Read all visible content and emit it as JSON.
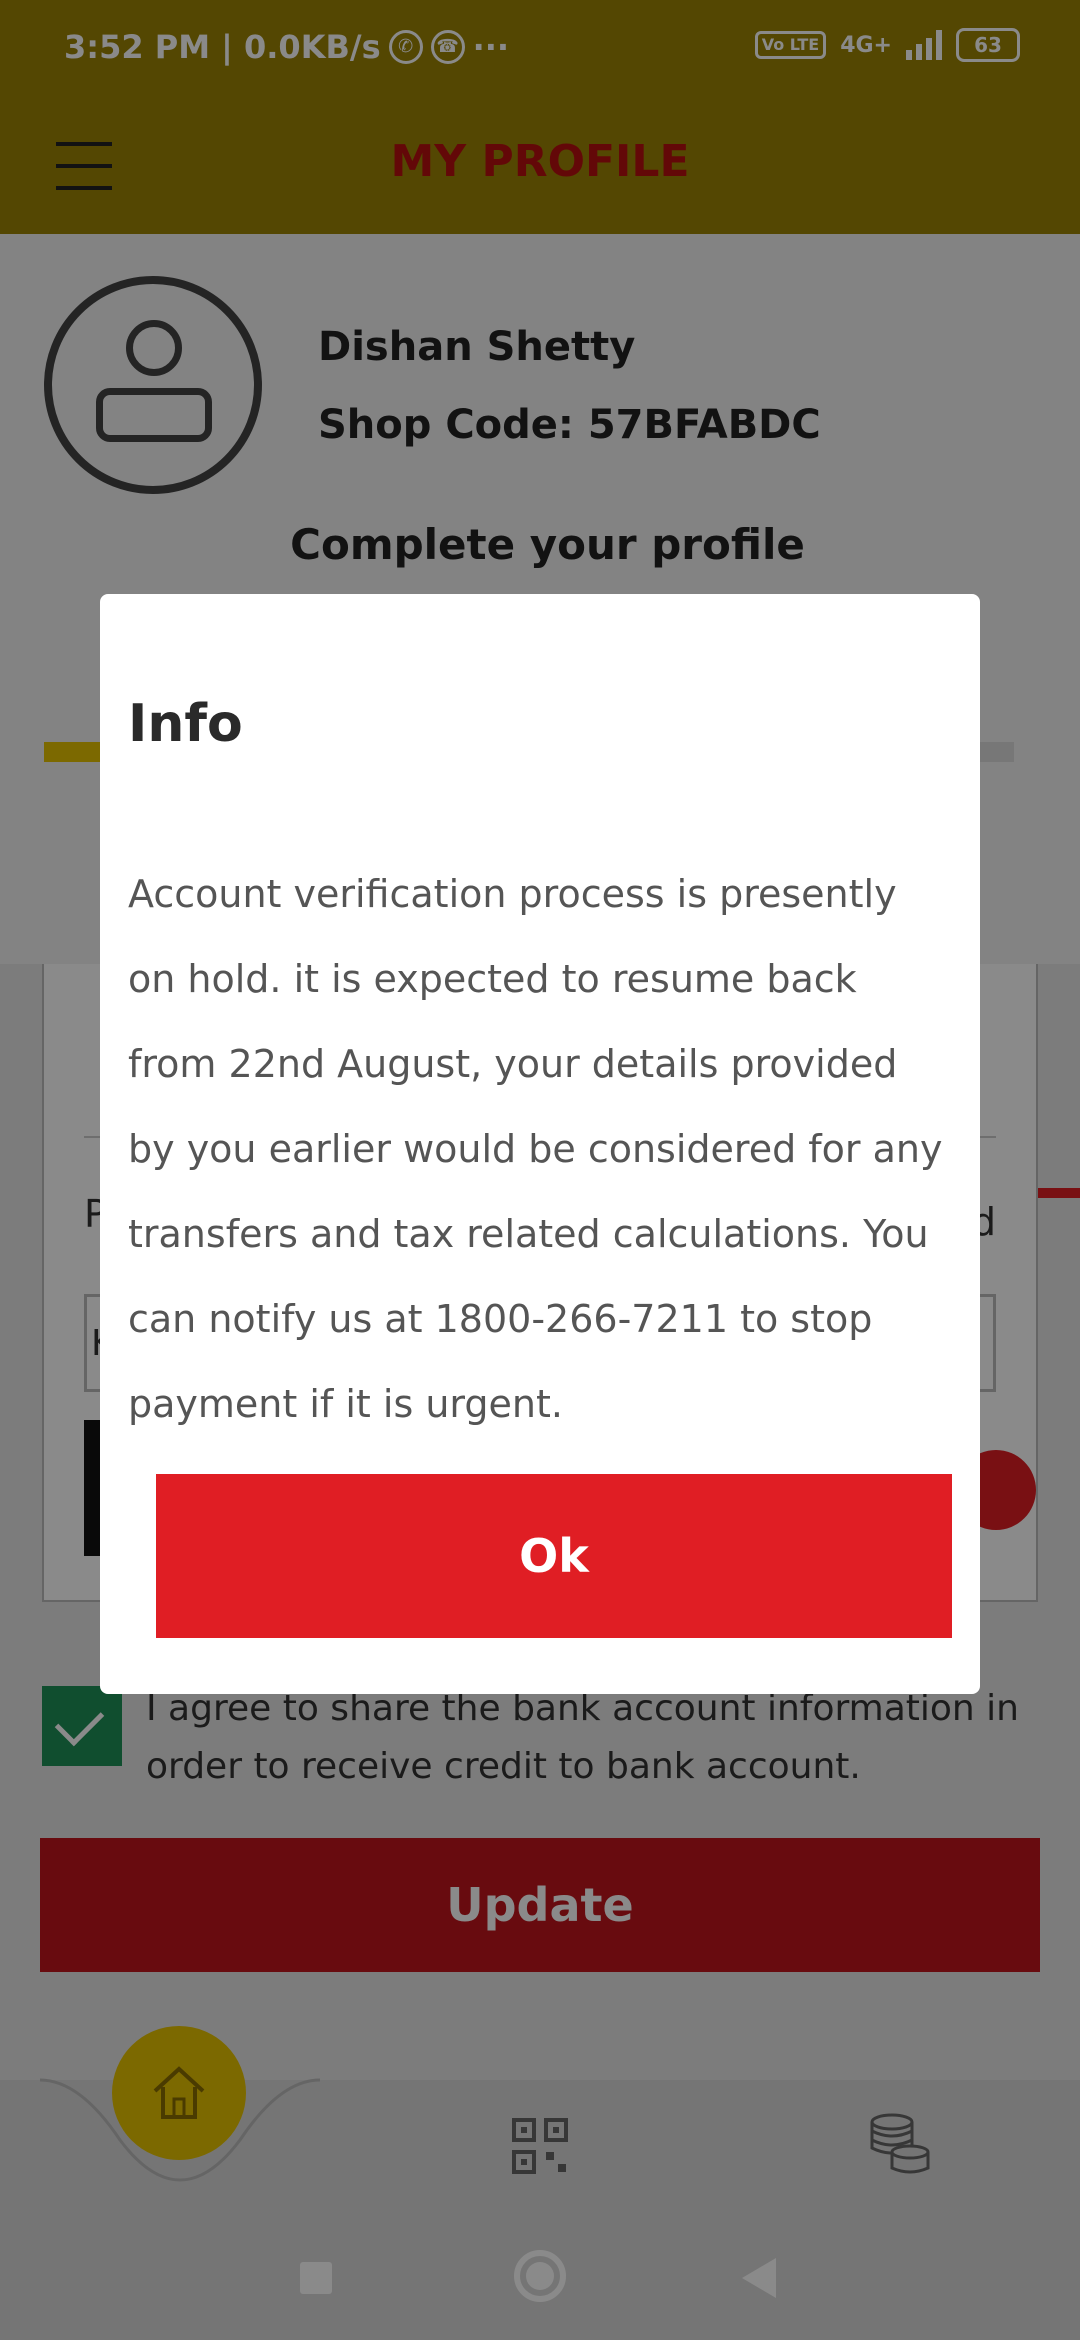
{
  "status_bar": {
    "time_speed": "3:52 PM | 0.0KB/s",
    "extra": "···",
    "network": "4G+",
    "volte": "Vo LTE",
    "battery": "63"
  },
  "app_bar": {
    "title": "MY PROFILE"
  },
  "profile": {
    "name": "Dishan Shetty",
    "shop_code": "Shop Code: 57BFABDC",
    "complete_label": "Complete your profile"
  },
  "bank_form_fragments": {
    "left_label": "P",
    "right_label": "d",
    "input_value": "K"
  },
  "agreement": {
    "checked": true,
    "text": "I agree to share the bank account information in order to receive credit to bank account."
  },
  "update_button": {
    "label": "Update"
  },
  "bottom_nav": {
    "items": [
      "home-icon",
      "qr-code-icon",
      "coins-icon"
    ]
  },
  "system_nav": {
    "items": [
      "recents-button",
      "home-button",
      "back-button"
    ]
  },
  "dialog": {
    "title": "Info",
    "message": "Account verification process is presently on hold. it is expected to resume back from 22nd August, your details provided by you earlier would be considered for any transfers and tax related calculations. You can notify us at 1800-266-7211 to stop payment if it is urgent.",
    "ok_label": "Ok"
  },
  "colors": {
    "header": "#9b8404",
    "title_red": "#b8100f",
    "accent_red": "#e01e24",
    "accent_yellow": "#e6c200",
    "check_green": "#1f9158"
  }
}
